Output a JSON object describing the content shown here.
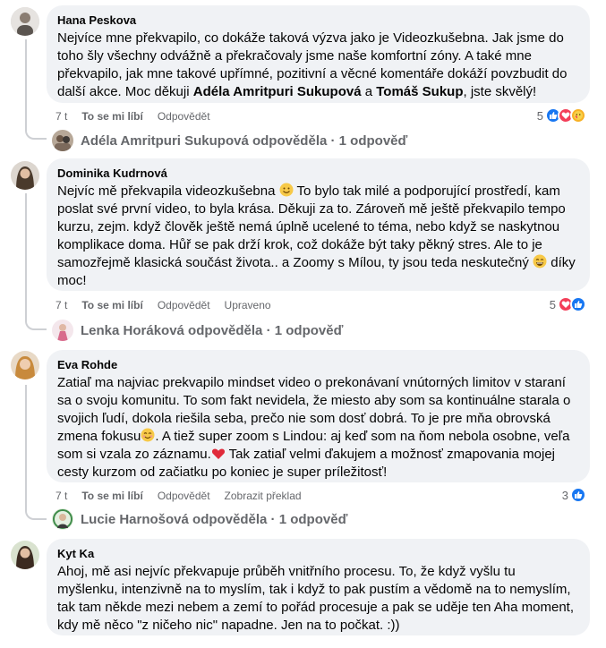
{
  "comments": [
    {
      "author": "Hana Peskova",
      "text_parts": [
        "Nejvíce mne překvapilo, co dokáže taková výzva jako je Videozkušebna. Jak jsme do toho šly všechny odvážně a překračovaly jsme naše komfortní zóny. A také mne překvapilo, jak mne takové upřímné, pozitivní a věcné komentáře dokáží povzbudit do další akce. Moc děkuji ",
        "Adéla Amritpuri Sukupová",
        " a ",
        "Tomáš Sukup",
        ", jste skvělý!"
      ],
      "time": "7 t",
      "like": "To se mi líbí",
      "reply": "Odpovědět",
      "reaction_count": "5",
      "reply_summary": "Adéla Amritpuri Sukupová odpověděla · 1 odpověď"
    },
    {
      "author": "Dominika Kudrnová",
      "text_1": "Nejvíc mě překvapila videozkušebna",
      "text_2": " To bylo tak milé a podporující prostředí, kam poslat své první video, to byla krása. Děkuji za to. Zároveň mě ještě překvapilo tempo kurzu, zejm. když člověk ještě nemá úplně ucelené to téma, nebo když se naskytnou komplikace doma. Hůř se pak drží krok, což dokáže být taky pěkný stres. Ale to je samozřejmě klasická součást života.. a Zoomy s Mílou, ty jsou teda neskutečný",
      "text_3": " díky moc!",
      "time": "7 t",
      "like": "To se mi líbí",
      "reply": "Odpovědět",
      "edited": "Upraveno",
      "reaction_count": "5",
      "reply_summary": "Lenka Horáková odpověděla · 1 odpověď"
    },
    {
      "author": "Eva Rohde",
      "text_1": "Zatiaľ ma najviac prekvapilo mindset video o prekonávaní vnútorných limitov v staraní sa o svoju komunitu. To som fakt nevidela, že miesto aby som sa kontinuálne starala o svojich ľudí, dokola riešila seba, prečo nie som dosť dobrá. To je pre mňa obrovská zmena fokusu",
      "text_2": ". A tiež super zoom s Lindou: aj keď som na ňom nebola osobne, veľa som si vzala zo záznamu.",
      "text_3": " Tak zatiaľ velmi ďakujem a možnosť zmapovania mojej cesty kurzom od začiatku po koniec je super príležitosť!",
      "time": "7 t",
      "like": "To se mi líbí",
      "reply": "Odpovědět",
      "translate": "Zobrazit překlad",
      "reaction_count": "3",
      "reply_summary": "Lucie Harnošová odpověděla · 1 odpověď"
    },
    {
      "author": "Kyt Ka",
      "text": "Ahoj, mě asi nejvíc překvapuje průběh vnitřního procesu. To, že když vyšlu tu myšlenku, intenzivně na to myslím, tak i když to pak pustím a vědomě na to nemyslím, tak tam někde mezi nebem a zemí to pořád procesuje a pak se uděje ten Aha moment, kdy mě něco \"z ničeho nic\" napadne. Jen na to počkat. :))"
    }
  ],
  "colors": {
    "bubble": "#f0f2f5",
    "meta": "#65676b",
    "like": "#1877f2",
    "love": "#f33e58",
    "care": "#f7b125"
  }
}
